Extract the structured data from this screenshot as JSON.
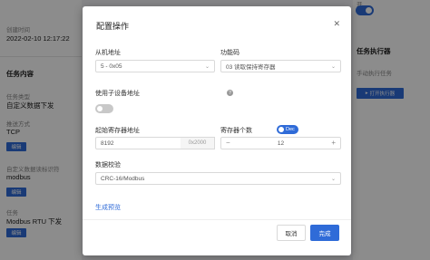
{
  "background": {
    "left": {
      "created_label": "创建时间",
      "created_value": "2022-02-10 12:17:22",
      "section_title": "任务内容",
      "task_type_label": "任务类型",
      "task_type_value": "自定义数据下发",
      "push_method_label": "推送方式",
      "push_method_value": "TCP",
      "edit_label": "编辑",
      "custom_format_label": "自定义数据读标识符",
      "custom_format_value": "modbus",
      "task_label": "任务",
      "task_value": "Modbus RTU 下发"
    },
    "right": {
      "top_value": "开",
      "section_title": "任务执行器",
      "manual_label": "手动执行任务",
      "run_button_label": "打开执行器"
    }
  },
  "modal": {
    "title": "配置操作",
    "close_icon": "close-icon",
    "slave_address": {
      "label": "从机地址",
      "value": "5 - 0x05"
    },
    "function_code": {
      "label": "功能码",
      "value": "03 读取保持寄存器"
    },
    "use_sub_device": {
      "label": "使用子设备地址",
      "enabled": false
    },
    "start_register": {
      "label": "起始寄存器地址",
      "value": "8192",
      "hex": "0x2000",
      "mode": "Dec"
    },
    "register_count": {
      "label": "寄存器个数",
      "value": "12",
      "minus": "−",
      "plus": "+"
    },
    "checksum": {
      "label": "数据校验",
      "value": "CRC-16/Modbus"
    },
    "generate_link": "生成预览",
    "cancel_label": "取消",
    "confirm_label": "完成"
  },
  "colors": {
    "accent": "#2f6bd8",
    "overlay": "rgba(0,0,0,0.45)"
  }
}
